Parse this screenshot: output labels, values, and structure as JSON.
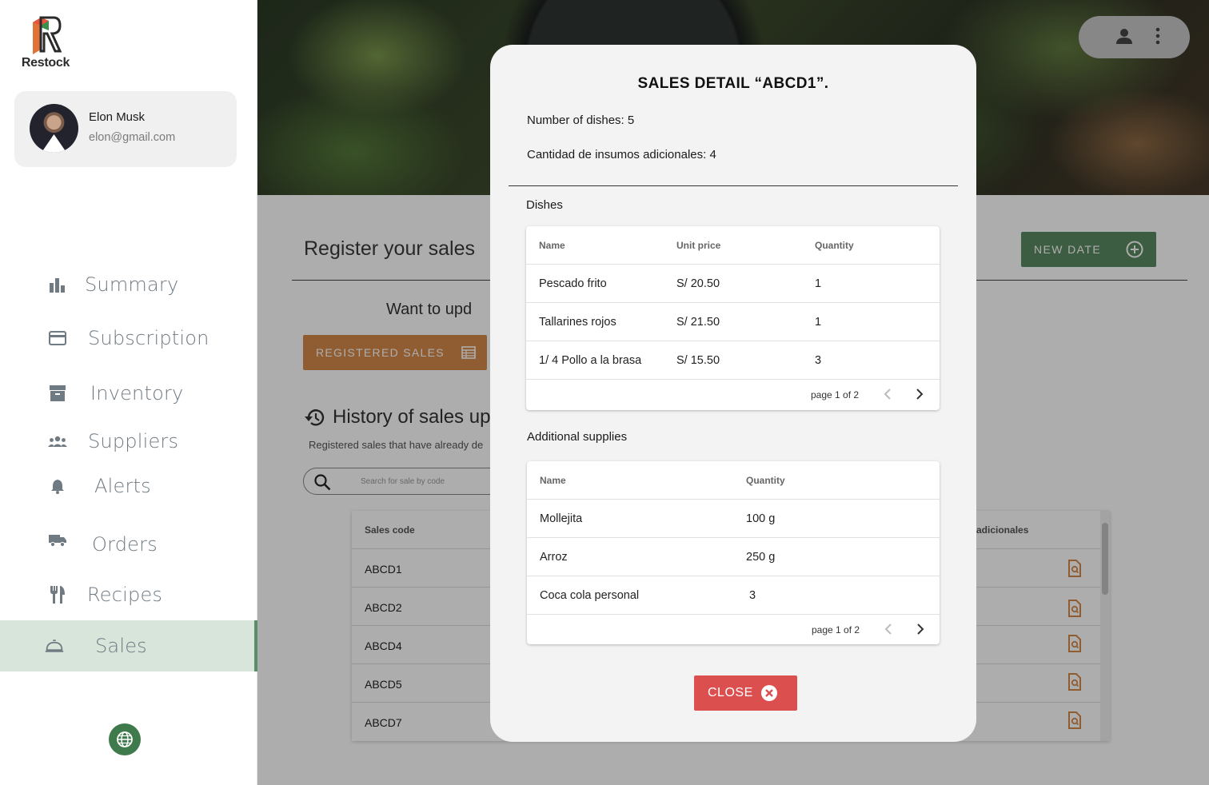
{
  "app": {
    "name": "Restock"
  },
  "user": {
    "name": "Elon Musk",
    "email": "elon@gmail.com"
  },
  "sidebar": {
    "items": [
      {
        "label": "Summary",
        "icon": "bar-chart-icon"
      },
      {
        "label": "Subscription",
        "icon": "credit-card-icon"
      },
      {
        "label": "Inventory",
        "icon": "archive-icon"
      },
      {
        "label": "Suppliers",
        "icon": "groups-icon"
      },
      {
        "label": "Alerts",
        "icon": "bell-icon"
      },
      {
        "label": "Orders",
        "icon": "truck-icon"
      },
      {
        "label": "Recipes",
        "icon": "fork-knife-icon"
      },
      {
        "label": "Sales",
        "icon": "room-service-icon",
        "active": true
      }
    ]
  },
  "page": {
    "title": "Register your sales",
    "new_date_label": "NEW DATE",
    "want_text": "Want to upd",
    "registered_sales_label": "REGISTERED SALES",
    "history_title": "History of sales up",
    "history_sub": "Registered sales that have already de",
    "search_placeholder": "Search for sale by code",
    "table": {
      "col_code": "Sales code",
      "col_additional": "s adicionales",
      "rows": [
        "ABCD1",
        "ABCD2",
        "ABCD4",
        "ABCD5",
        "ABCD7"
      ]
    }
  },
  "modal": {
    "title": "SALES DETAIL “ABCD1”.",
    "dishes_count": "Number of dishes: 5",
    "supplies_count": "Cantidad de insumos adicionales: 4",
    "dishes_section": "Dishes",
    "dishes_table": {
      "headers": {
        "name": "Name",
        "unit_price": "Unit price",
        "quantity": "Quantity"
      },
      "rows": [
        {
          "name": "Pescado frito",
          "price": "S/ 20.50",
          "qty": "1"
        },
        {
          "name": "Tallarines rojos",
          "price": "S/ 21.50",
          "qty": "1"
        },
        {
          "name": "1/ 4 Pollo a la brasa",
          "price": "S/ 15.50",
          "qty": "3"
        }
      ],
      "pagination": "page 1 of 2"
    },
    "supplies_section": "Additional supplies",
    "supplies_table": {
      "headers": {
        "name": "Name",
        "quantity": "Quantity"
      },
      "rows": [
        {
          "name": "Mollejita",
          "qty": "100 g"
        },
        {
          "name": "Arroz",
          "qty": "250 g"
        },
        {
          "name": "Coca cola personal",
          "qty": "3"
        }
      ],
      "pagination": "page 1 of 2"
    },
    "close_label": "CLOSE"
  },
  "colors": {
    "sidebar_active_bg": "#d8e5db",
    "primary_green": "#5a8a63",
    "orange": "#d58a4a",
    "close_red": "#dc4f4f"
  }
}
